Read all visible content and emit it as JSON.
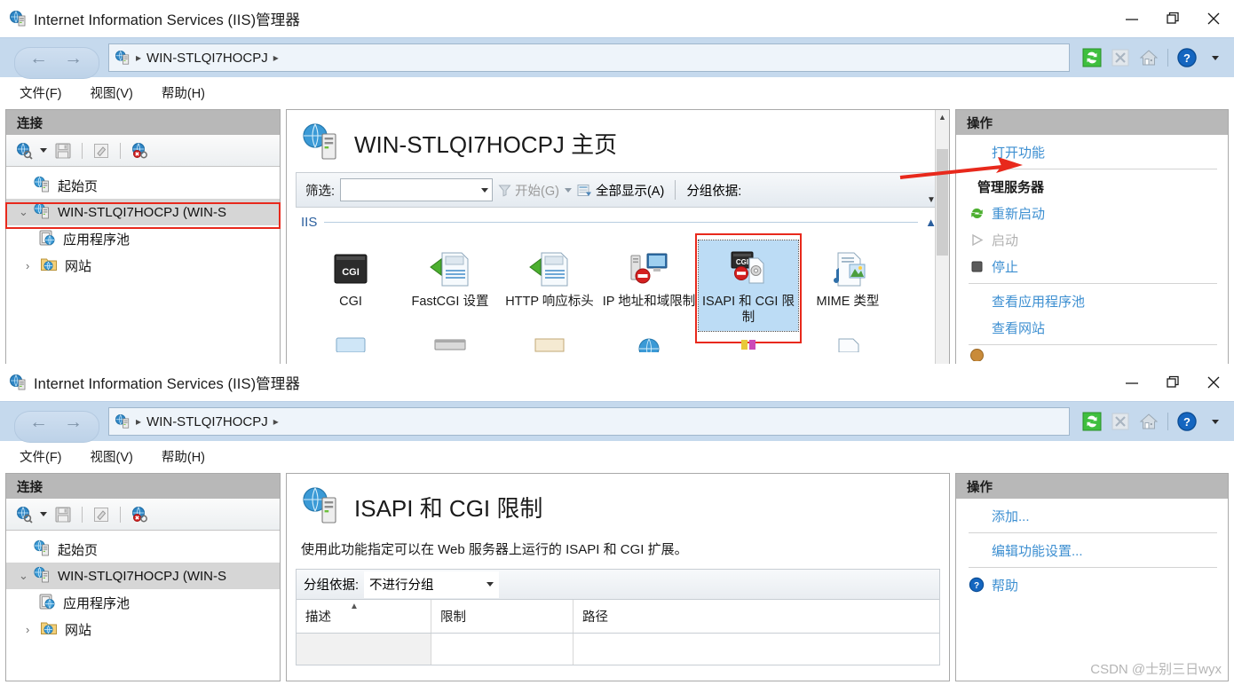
{
  "app": {
    "title": "Internet Information Services (IIS)管理器",
    "title_icon": "iis-manager-icon"
  },
  "window_controls": {
    "minimize": "minimize-icon",
    "restore": "restore-icon",
    "close": "close-icon"
  },
  "addressbar": {
    "back": "back-arrow-icon",
    "forward": "forward-arrow-icon",
    "crumb_icon": "server-icon",
    "crumb_text": "WIN-STLQI7HOCPJ",
    "sep": "▸",
    "tools": {
      "refresh": "refresh-icon",
      "stop": "stop-icon",
      "home": "home-icon",
      "help": "help-icon",
      "dropdown": "chevron-down-icon"
    }
  },
  "menubar": {
    "items": [
      {
        "label": "文件(F)",
        "name": "menu-file"
      },
      {
        "label": "视图(V)",
        "name": "menu-view"
      },
      {
        "label": "帮助(H)",
        "name": "menu-help"
      }
    ]
  },
  "connections": {
    "header": "连接",
    "toolbar": [
      {
        "name": "connect-to-icon",
        "glyph": "globe"
      },
      {
        "name": "save-icon",
        "glyph": "save"
      },
      {
        "name": "edit-icon",
        "glyph": "edit"
      },
      {
        "name": "disconnect-icon",
        "glyph": "globe-x"
      }
    ],
    "tree": [
      {
        "label": "起始页",
        "icon": "start-page-icon",
        "level": 1,
        "twist": "",
        "selected": false
      },
      {
        "label": "WIN-STLQI7HOCPJ (WIN-S",
        "icon": "server-icon",
        "level": 1,
        "twist": "⌄",
        "selected": true
      },
      {
        "label": "应用程序池",
        "icon": "app-pools-icon",
        "level": 2,
        "twist": "",
        "selected": false
      },
      {
        "label": "网站",
        "icon": "sites-folder-icon",
        "level": 2,
        "twist": "›",
        "selected": false
      }
    ]
  },
  "window1": {
    "page_title": "WIN-STLQI7HOCPJ 主页",
    "page_icon": "server-home-icon",
    "filterbar": {
      "label": "筛选:",
      "input_value": "",
      "go_label": "开始(G)",
      "go_icon": "funnel-icon",
      "showall_label": "全部显示(A)",
      "showall_icon": "show-all-icon",
      "groupby_label": "分组依据:"
    },
    "section": {
      "name": "IIS",
      "collapse_icon": "chevron-up-icon"
    },
    "features": [
      {
        "label": "CGI",
        "icon": "cgi-icon",
        "selected": false
      },
      {
        "label": "FastCGI 设置",
        "icon": "fastcgi-settings-icon",
        "selected": false
      },
      {
        "label": "HTTP 响应标头",
        "icon": "http-response-headers-icon",
        "selected": false
      },
      {
        "label": "IP 地址和域限制",
        "icon": "ip-domain-restrictions-icon",
        "selected": false
      },
      {
        "label": "ISAPI 和 CGI 限制",
        "icon": "isapi-cgi-restrictions-icon",
        "selected": true
      },
      {
        "label": "MIME 类型",
        "icon": "mime-types-icon",
        "selected": false
      }
    ],
    "actions": {
      "header": "操作",
      "items": [
        {
          "label": "打开功能",
          "icon": "",
          "kind": "link",
          "indent": true
        },
        {
          "kind": "separator"
        },
        {
          "label": "管理服务器",
          "kind": "group-header"
        },
        {
          "label": "重新启动",
          "icon": "restart-icon",
          "kind": "link"
        },
        {
          "label": "启动",
          "icon": "start-icon",
          "kind": "disabled"
        },
        {
          "label": "停止",
          "icon": "stop-square-icon",
          "kind": "link"
        },
        {
          "kind": "separator"
        },
        {
          "label": "查看应用程序池",
          "kind": "link",
          "indent": true
        },
        {
          "label": "查看网站",
          "kind": "link",
          "indent": true
        },
        {
          "kind": "separator"
        }
      ]
    }
  },
  "window2": {
    "page_title": "ISAPI 和 CGI 限制",
    "page_icon": "server-home-icon",
    "description": "使用此功能指定可以在 Web 服务器上运行的 ISAPI 和 CGI 扩展。",
    "groupby": {
      "label": "分组依据:",
      "value": "不进行分组"
    },
    "table": {
      "columns": [
        "描述",
        "限制",
        "路径"
      ],
      "sort_column": 0,
      "sort_dir": "asc",
      "rows": []
    },
    "actions": {
      "header": "操作",
      "items": [
        {
          "label": "添加...",
          "kind": "link",
          "indent": true
        },
        {
          "kind": "separator"
        },
        {
          "label": "编辑功能设置...",
          "kind": "link",
          "indent": true
        },
        {
          "kind": "separator"
        },
        {
          "label": "帮助",
          "icon": "help-icon",
          "kind": "link"
        }
      ]
    }
  },
  "annotations": {
    "arrow_color": "#e8291c",
    "highlight_color": "#e8291c"
  },
  "watermark": "CSDN @士别三日wyx"
}
